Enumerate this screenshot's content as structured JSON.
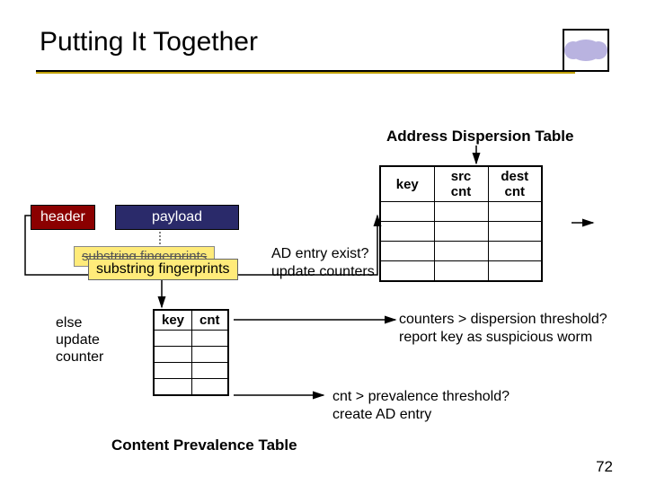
{
  "title": "Putting It Together",
  "adt": {
    "label": "Address Dispersion Table",
    "cols": [
      "key",
      "src cnt",
      "dest cnt"
    ]
  },
  "packet": {
    "header": "header",
    "payload": "payload"
  },
  "substring_back": "substring fingerprints",
  "substring_front": "substring fingerprints",
  "ad_entry_q": "AD entry exist?",
  "update_counters": "update counters",
  "else_update": "else\nupdate\ncounter",
  "cpt": {
    "label": "Content Prevalence Table",
    "cols": [
      "key",
      "cnt"
    ]
  },
  "dispersion": "counters > dispersion threshold?\nreport key as suspicious worm",
  "prevalence": "cnt > prevalence threshold?\ncreate AD entry",
  "page": "72"
}
